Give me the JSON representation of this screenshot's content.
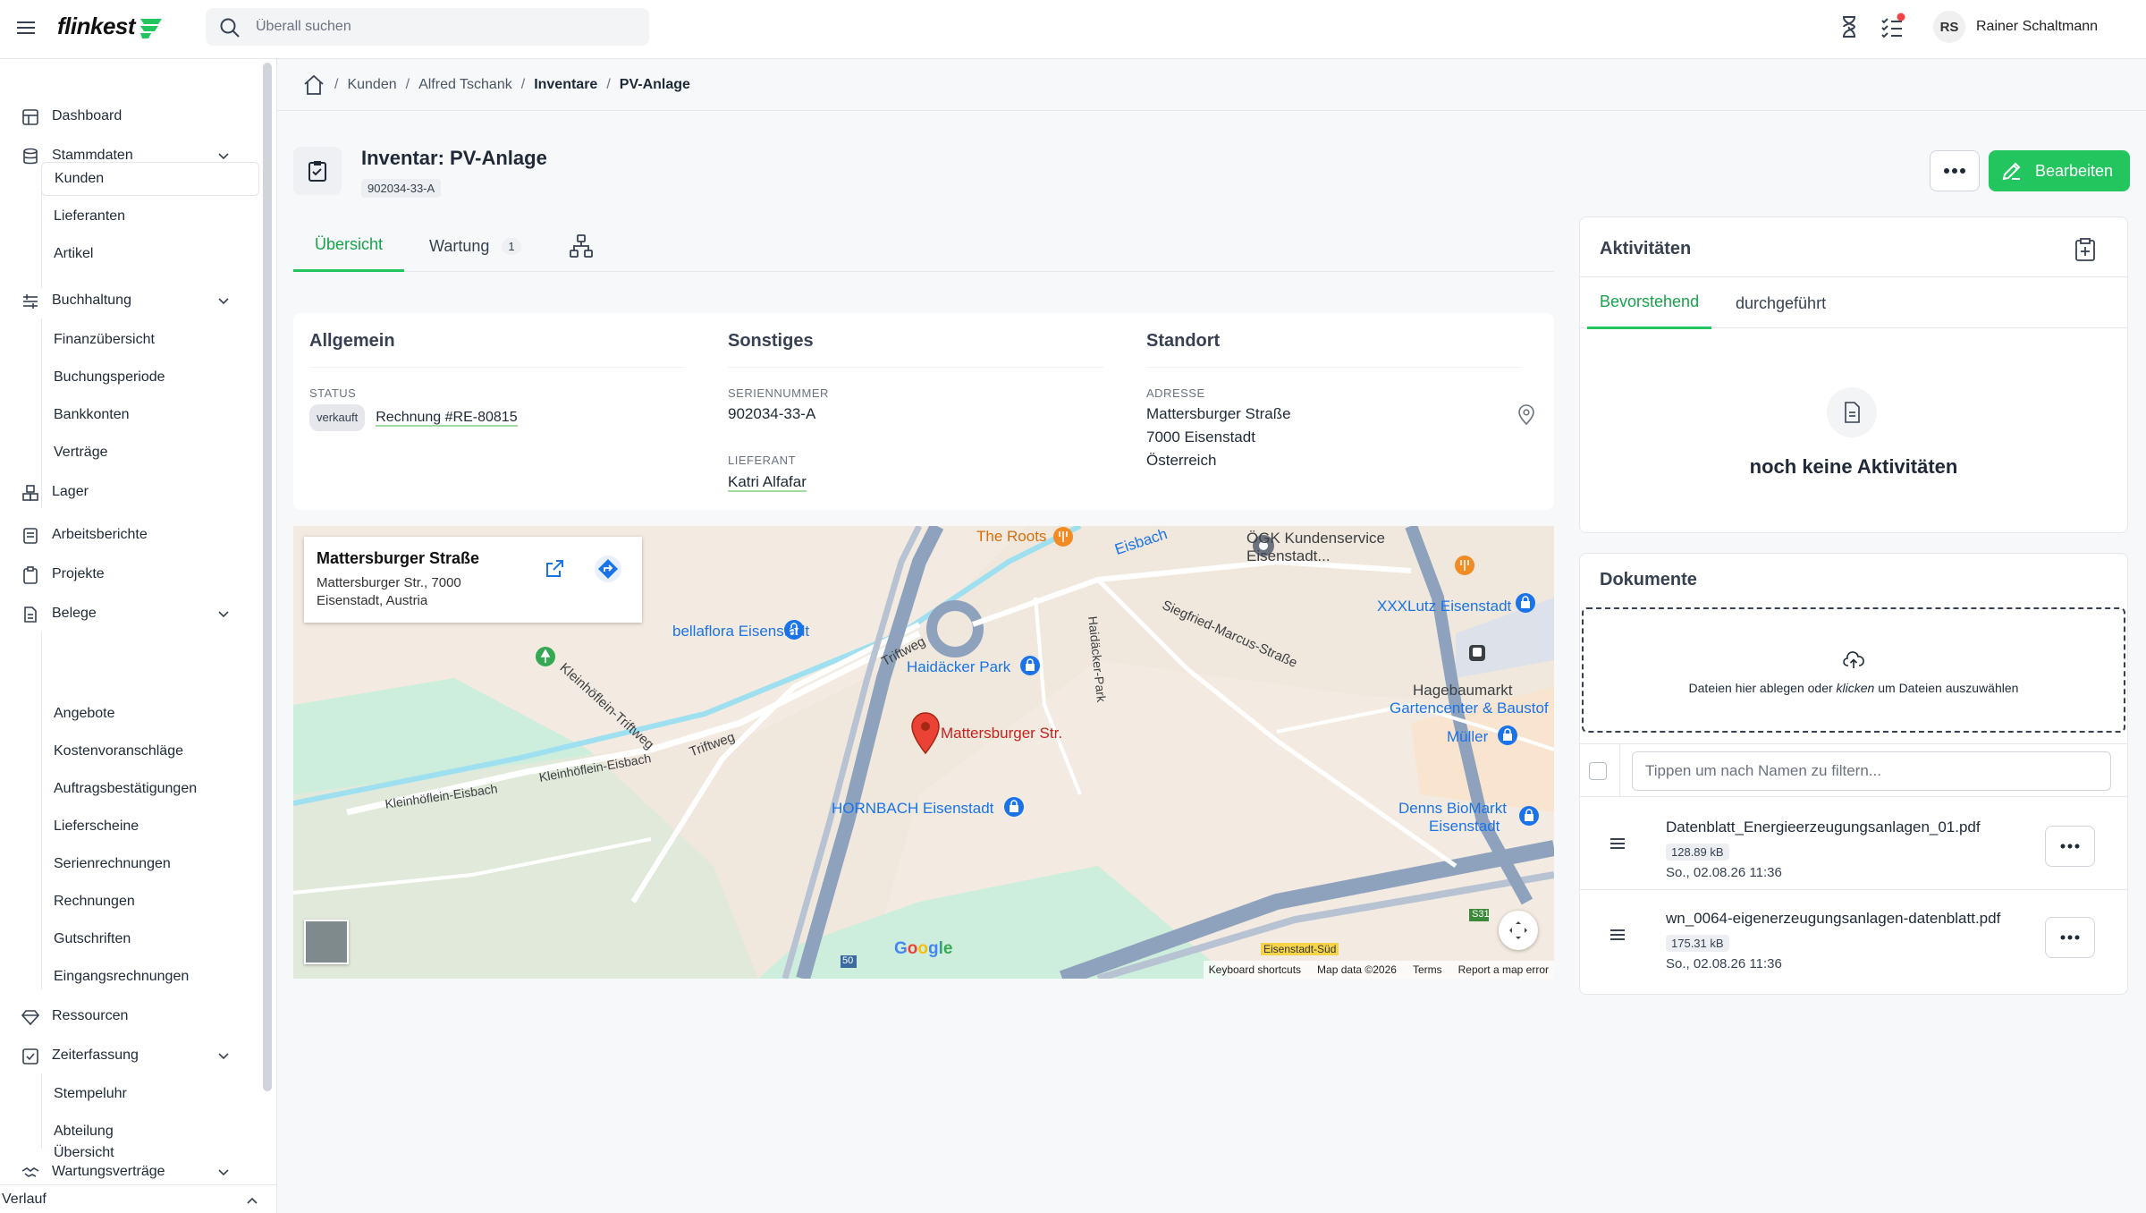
{
  "topbar": {
    "logo": "flinkest",
    "search_placeholder": "Überall suchen",
    "user_initials": "RS",
    "user_name": "Rainer Schaltmann"
  },
  "sidebar": {
    "items": {
      "dashboard": "Dashboard",
      "stammdaten": "Stammdaten",
      "kunden": "Kunden",
      "lieferanten": "Lieferanten",
      "artikel": "Artikel",
      "buchhaltung": "Buchhaltung",
      "finanzuebersicht": "Finanzübersicht",
      "buchungsperiode": "Buchungsperiode",
      "bankkonten": "Bankkonten",
      "vertraege": "Verträge",
      "lager": "Lager",
      "arbeitsberichte": "Arbeitsberichte",
      "projekte": "Projekte",
      "belege": "Belege",
      "angebote": "Angebote",
      "kostenvoranschlaege": "Kostenvoranschläge",
      "auftragsbestaetigungen": "Auftragsbestätigungen",
      "lieferscheine": "Lieferscheine",
      "serienrechnungen": "Serienrechnungen",
      "rechnungen": "Rechnungen",
      "gutschriften": "Gutschriften",
      "eingangsrechnungen": "Eingangsrechnungen",
      "ressourcen": "Ressourcen",
      "zeiterfassung": "Zeiterfassung",
      "stempeluhr": "Stempeluhr",
      "abteilung": "Abteilung",
      "wartungsvertraege": "Wartungsverträge",
      "uebersicht": "Übersicht"
    },
    "verlauf": "Verlauf"
  },
  "breadcrumb": {
    "items": [
      "Kunden",
      "Alfred Tschank",
      "Inventare",
      "PV-Anlage"
    ],
    "separator": "/"
  },
  "header": {
    "title": "Inventar: PV-Anlage",
    "badge": "902034-33-A",
    "edit_label": "Bearbeiten"
  },
  "tabs": {
    "overview": "Übersicht",
    "maintenance": "Wartung",
    "maintenance_count": "1"
  },
  "info": {
    "allgemein": {
      "title": "Allgemein",
      "status_label": "Status",
      "status_chip": "verkauft",
      "invoice_link": "Rechnung #RE-80815"
    },
    "sonstiges": {
      "title": "Sonstiges",
      "serial_label": "Seriennummer",
      "serial_value": "902034-33-A",
      "supplier_label": "Lieferant",
      "supplier_value": "Katri Alfafar"
    },
    "standort": {
      "title": "Standort",
      "address_label": "Adresse",
      "line1": "Mattersburger Straße",
      "line2": "7000 Eisenstadt",
      "line3": "Österreich"
    }
  },
  "map": {
    "info_title": "Mattersburger Straße",
    "info_address": "Mattersburger Str., 7000 Eisenstadt, Austria",
    "pin_label": "Mattersburger Str.",
    "labels": {
      "the_roots": "The Roots",
      "eisbach": "Eisbach",
      "oegk": "ÖGK Kundenservice",
      "oegk2": "Eisenstadt...",
      "xxxlutz": "XXXLutz Eisenstadt",
      "siegfried": "Siegfried-Marcus-Straße",
      "haidacker_park_road": "Haidäcker-Park",
      "bellaflora": "bellaflora Eisenstadt",
      "haidacker_park": "Haidäcker Park",
      "triftweg": "Triftweg",
      "kleinhoeflein_triftweg": "Kleinhöflein-Triftweg",
      "triftweg2": "Triftweg",
      "kleinhoeflein_eisbach": "Kleinhöflein-Eisbach",
      "kleinhoeflein_eisbach2": "Kleinhöflein-Eisbach",
      "hagebau": "Hagebaumarkt",
      "hagebau2": "Gartencenter & Baustof",
      "mueller": "Müller",
      "hornbach": "HORNBACH Eisenstadt",
      "denns": "Denns BioMarkt",
      "denns2": "Eisenstadt",
      "s31": "S31",
      "a50": "50",
      "eisenstadt_sued": "Eisenstadt-Süd",
      "google": "Google"
    },
    "footer": {
      "shortcuts": "Keyboard shortcuts",
      "data": "Map data ©2026",
      "terms": "Terms",
      "report": "Report a map error"
    }
  },
  "activities": {
    "title": "Aktivitäten",
    "tab_upcoming": "Bevorstehend",
    "tab_done": "durchgeführt",
    "empty": "noch keine Aktivitäten"
  },
  "documents": {
    "title": "Dokumente",
    "drop_text_1": "Dateien hier ablegen oder ",
    "drop_text_em": "klicken",
    "drop_text_2": " um Dateien auszuwählen",
    "filter_placeholder": "Tippen um nach Namen zu filtern...",
    "files": [
      {
        "name": "Datenblatt_Energieerzeugungsanlagen_01.pdf",
        "size": "128.89 kB",
        "date": "So., 02.08.26 11:36"
      },
      {
        "name": "wn_0064-eigenerzeugungsanlagen-datenblatt.pdf",
        "size": "175.31 kB",
        "date": "So., 02.08.26 11:36"
      }
    ]
  },
  "colors": {
    "accent": "#22c55e",
    "accent_text": "#16a34a"
  }
}
